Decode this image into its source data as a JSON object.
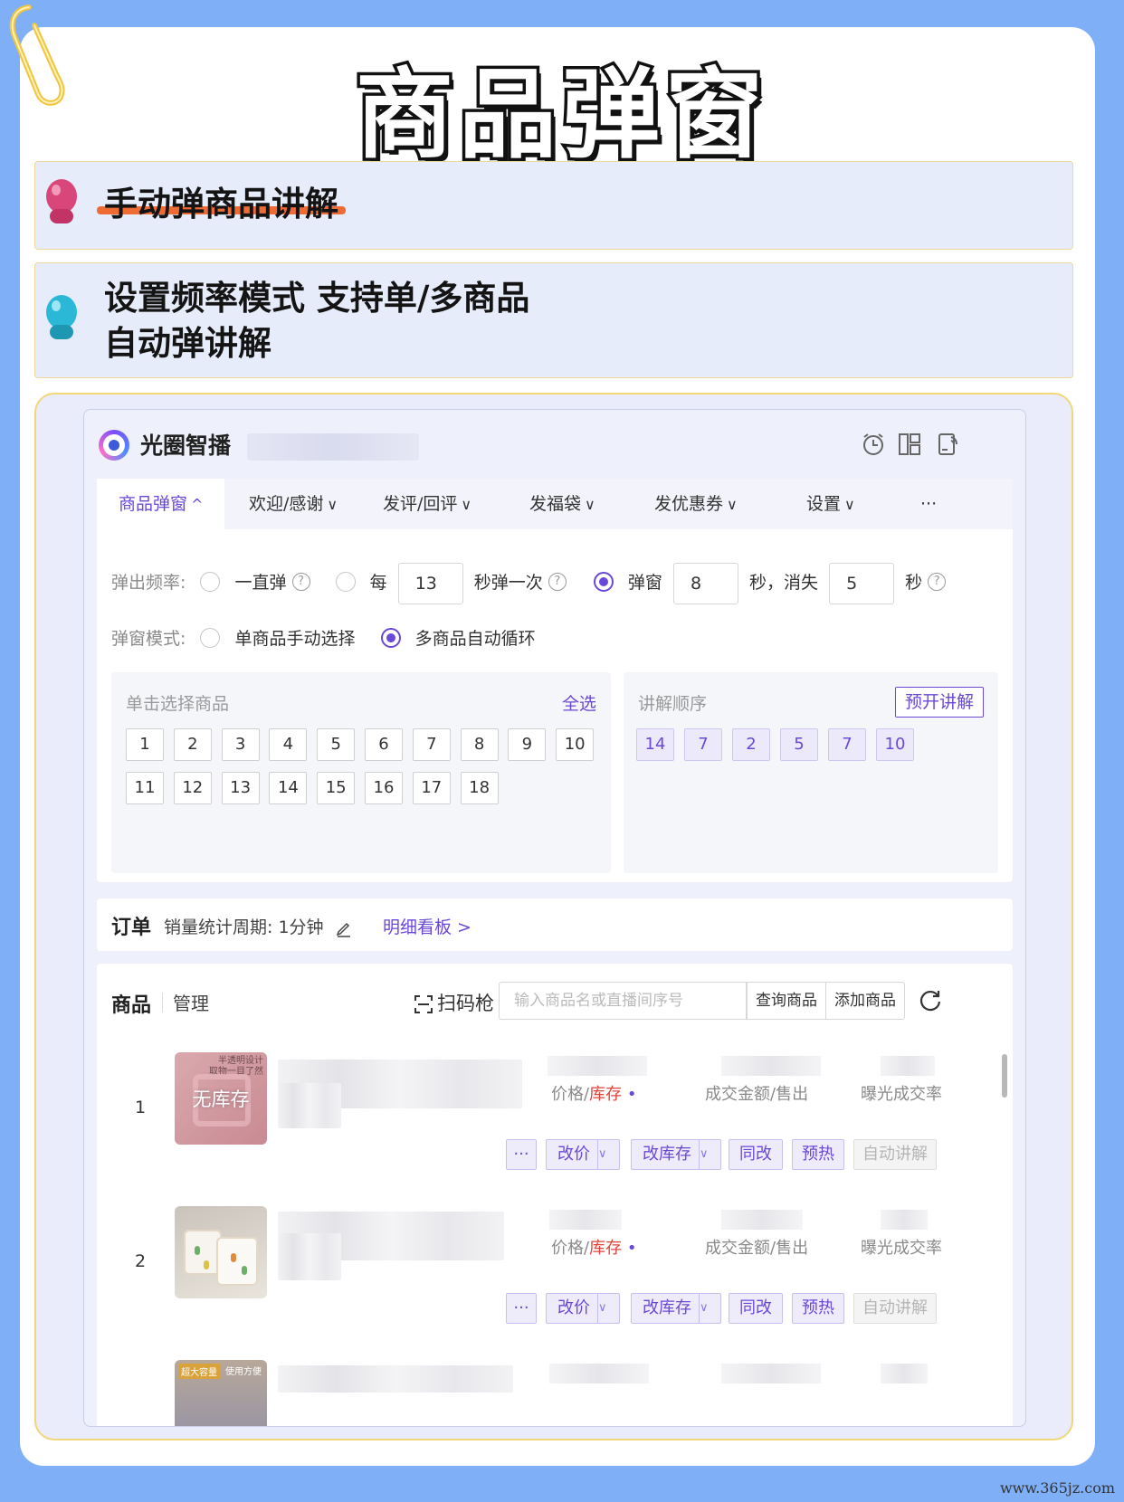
{
  "headline": "商品弹窗",
  "bands": {
    "b1": "手动弹商品讲解",
    "b2_line1": "设置频率模式 支持单/多商品",
    "b2_line2": "自动弹讲解"
  },
  "app": {
    "title": "光圈智播",
    "tabs": [
      {
        "label": "商品弹窗",
        "arrow": "^"
      },
      {
        "label": "欢迎/感谢",
        "arrow": "∨"
      },
      {
        "label": "发评/回评",
        "arrow": "∨"
      },
      {
        "label": "发福袋",
        "arrow": "∨"
      },
      {
        "label": "发优惠券",
        "arrow": "∨"
      },
      {
        "label": "设置",
        "arrow": "∨"
      },
      {
        "label": "···",
        "arrow": ""
      }
    ],
    "freq": {
      "label": "弹出频率:",
      "opt1": "一直弹",
      "opt2_pre": "每",
      "opt2_val": "13",
      "opt2_post": "秒弹一次",
      "opt3_pre": "弹窗",
      "opt3_val": "8",
      "opt3_mid": "秒，消失",
      "opt3_val2": "5",
      "opt3_post": "秒",
      "help": "?"
    },
    "mode": {
      "label": "弹窗模式:",
      "opt1": "单商品手动选择",
      "opt2": "多商品自动循环"
    },
    "select_box": {
      "caption": "单击选择商品",
      "select_all": "全选",
      "numbers": [
        "1",
        "2",
        "3",
        "4",
        "5",
        "6",
        "7",
        "8",
        "9",
        "10",
        "11",
        "12",
        "13",
        "14",
        "15",
        "16",
        "17",
        "18"
      ]
    },
    "order_box": {
      "caption": "讲解顺序",
      "button": "预开讲解",
      "numbers": [
        "14",
        "7",
        "2",
        "5",
        "7",
        "10"
      ]
    },
    "orders": {
      "title": "订单",
      "period": "销量统计周期: 1分钟",
      "link": "明细看板 >"
    },
    "products": {
      "title": "商品",
      "manage": "管理",
      "scan": "扫码枪",
      "search_placeholder": "输入商品名或直播间序号",
      "query_btn": "查询商品",
      "add_btn": "添加商品",
      "meta_price": "价格/",
      "meta_stock": "库存",
      "meta_dot": "•",
      "meta_deal": "成交金额/售出",
      "meta_rate": "曝光成交率",
      "actions": {
        "more": "···",
        "price": "改价",
        "stock": "改库存",
        "same": "同改",
        "warm": "预热",
        "auto": "自动讲解",
        "dd": "∨"
      },
      "items": [
        {
          "index": "1",
          "overlay": "无库存",
          "tag1": "半透明设计",
          "tag2": "取物一目了然"
        },
        {
          "index": "2"
        },
        {
          "tag1": "超大容量",
          "tag2": "使用方便"
        }
      ]
    }
  },
  "watermark": "www.365jz.com",
  "colors": {
    "accent": "#6a48d8",
    "page_bg": "#7fb0f7",
    "strike": "#ee6429",
    "pin1": "#d9467a",
    "pin2": "#2bb8d6"
  }
}
